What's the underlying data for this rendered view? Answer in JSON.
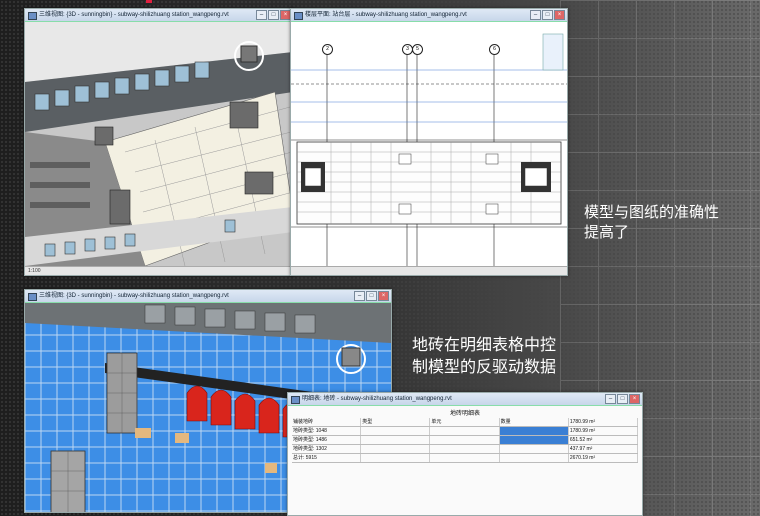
{
  "window_tl": {
    "title": "三维视图: {3D - sunningbin} - subway-shilizhuang station_wangpeng.rvt"
  },
  "window_tr": {
    "title": "楼层平面: 站台层 - subway-shilizhuang station_wangpeng.rvt"
  },
  "window_bl": {
    "title": "三维视图: {3D - sunningbin} - subway-shilizhuang station_wangpeng.rvt"
  },
  "window_schedule": {
    "title": "明细表: 地砖 - subway-shilizhuang station_wangpeng.rvt",
    "header": "地砖明细表",
    "rows": [
      [
        "铺装地砖",
        "类型",
        "单元",
        "数量",
        "1780.99 m²"
      ],
      [
        "地砖类型: 1048",
        "",
        "",
        "",
        "1780.99 m²"
      ],
      [
        "地砖类型: 1486",
        "",
        "",
        "",
        "651.52 m²"
      ],
      [
        "地砖类型: 1302",
        "",
        "",
        "",
        "437.97 m²"
      ],
      [
        "总计: 5915",
        "",
        "",
        "",
        "2670.19 m²"
      ]
    ]
  },
  "tl_status": "1:100",
  "grid_labels": [
    "2",
    "3",
    "5",
    "6"
  ],
  "captions": {
    "accuracy_line1": "模型与图纸的准确性",
    "accuracy_line2": "提高了",
    "tile_line1": "地砖在明细表格中控",
    "tile_line2": "制模型的反驱动数据"
  },
  "colors": {
    "caption": "#ffffff",
    "turnstile": "#d9251c",
    "floor_blue": "#3d8ee6"
  }
}
